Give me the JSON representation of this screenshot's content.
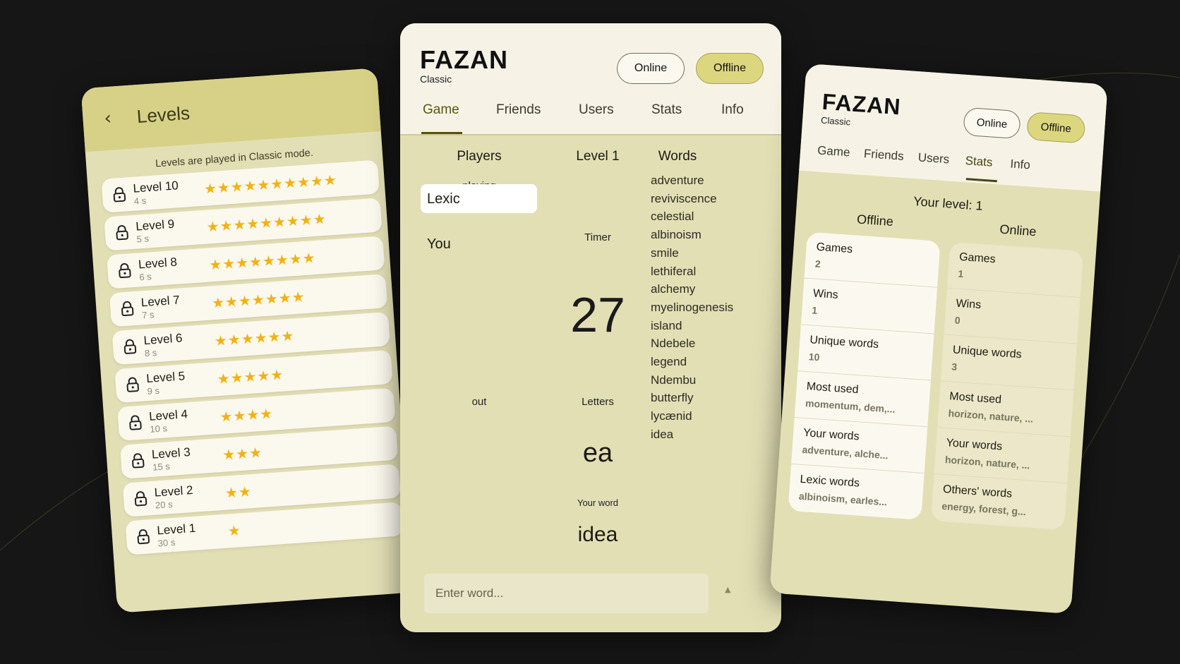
{
  "colors": {
    "background": "#161616",
    "card": "#e3dfb5",
    "header": "#d7d187",
    "accent_button": "#dcd67e",
    "star": "#f2b211"
  },
  "levels_screen": {
    "title": "Levels",
    "back_icon": "chevron-left-icon",
    "note": "Levels are played in Classic mode.",
    "levels": [
      {
        "name": "Level 10",
        "time": "4 s",
        "stars": "★★★★★★★★★★"
      },
      {
        "name": "Level 9",
        "time": "5 s",
        "stars": "★★★★★★★★★"
      },
      {
        "name": "Level 8",
        "time": "6 s",
        "stars": "★★★★★★★★"
      },
      {
        "name": "Level 7",
        "time": "7 s",
        "stars": "★★★★★★★"
      },
      {
        "name": "Level 6",
        "time": "8 s",
        "stars": "★★★★★★"
      },
      {
        "name": "Level 5",
        "time": "9 s",
        "stars": "★★★★★"
      },
      {
        "name": "Level 4",
        "time": "10 s",
        "stars": "★★★★"
      },
      {
        "name": "Level 3",
        "time": "15 s",
        "stars": "★★★"
      },
      {
        "name": "Level 2",
        "time": "20 s",
        "stars": "★★"
      },
      {
        "name": "Level 1",
        "time": "30 s",
        "stars": "★"
      }
    ]
  },
  "game_screen": {
    "logo": "FAZAN",
    "logo_sub": "Classic",
    "online_label": "Online",
    "offline_label": "Offline",
    "tabs": [
      "Game",
      "Friends",
      "Users",
      "Stats",
      "Info"
    ],
    "players_header": "Players",
    "level_header": "Level 1",
    "words_header": "Words",
    "playing_label": "playing",
    "player_current": "Lexic",
    "player_you": "You",
    "out_label": "out",
    "timer_label": "Timer",
    "timer_value": "27",
    "letters_label": "Letters",
    "letters_value": "ea",
    "your_word_label": "Your word",
    "your_word_value": "idea",
    "input_placeholder": "Enter word...",
    "words": [
      "adventure",
      "reviviscence",
      "celestial",
      "albinoism",
      "smile",
      "lethiferal",
      "alchemy",
      "myelinogenesis",
      "island",
      "Ndebele",
      "legend",
      "Ndembu",
      "butterfly",
      "lycænid",
      "idea"
    ]
  },
  "stats_screen": {
    "logo": "FAZAN",
    "logo_sub": "Classic",
    "online_label": "Online",
    "offline_label": "Offline",
    "tabs": [
      "Game",
      "Friends",
      "Users",
      "Stats",
      "Info"
    ],
    "your_level": "Your level: 1",
    "offline_header": "Offline",
    "online_header": "Online",
    "offline_stats": [
      {
        "label": "Games",
        "value": "2"
      },
      {
        "label": "Wins",
        "value": "1"
      },
      {
        "label": "Unique words",
        "value": "10"
      },
      {
        "label": "Most used",
        "value": "momentum, dem,..."
      },
      {
        "label": "Your words",
        "value": "adventure, alche..."
      },
      {
        "label": "Lexic words",
        "value": "albinoism, earles..."
      }
    ],
    "online_stats": [
      {
        "label": "Games",
        "value": "1"
      },
      {
        "label": "Wins",
        "value": "0"
      },
      {
        "label": "Unique words",
        "value": "3"
      },
      {
        "label": "Most used",
        "value": "horizon, nature, ..."
      },
      {
        "label": "Your words",
        "value": "horizon, nature, ..."
      },
      {
        "label": "Others' words",
        "value": "energy, forest, g..."
      }
    ]
  }
}
